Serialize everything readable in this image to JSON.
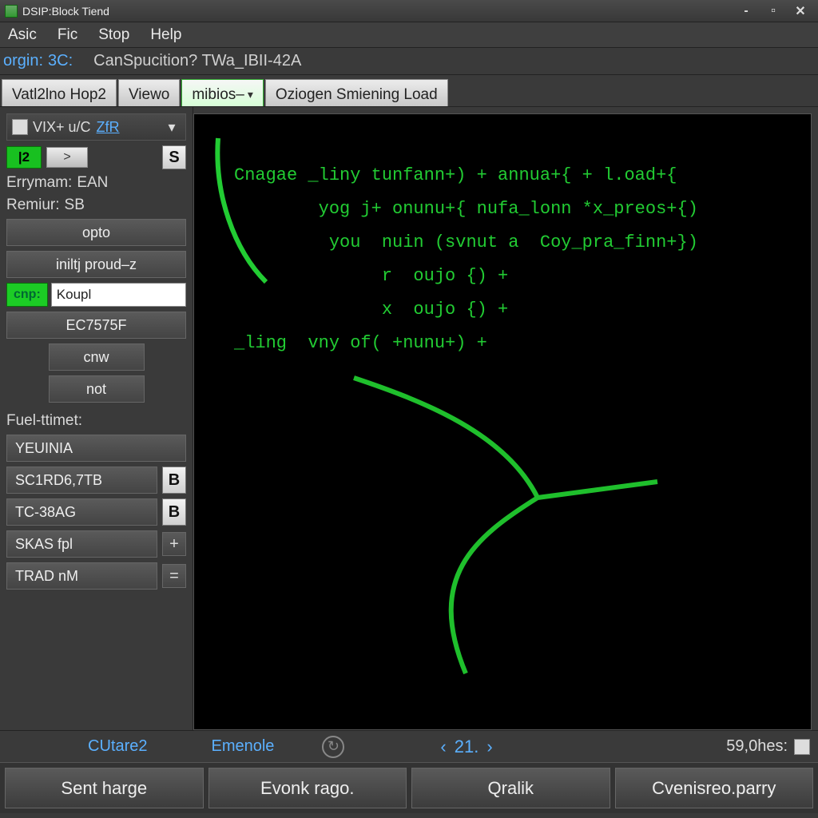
{
  "titlebar": {
    "title": "DSIP:Block Tiend"
  },
  "menubar": [
    "Asic",
    "Fic",
    "Stop",
    "Help"
  ],
  "info": {
    "label": "orgin:",
    "val1": "3C:",
    "val2": "CanSpucition?  TWa_IBII-42A"
  },
  "tabs": {
    "t1": "Vatl2lno Hop2",
    "t2": "Viewo",
    "t3": "mibios–",
    "t4": "Oziogen Smiening Load"
  },
  "sidebar": {
    "header_a": "VIX+ u/C ",
    "header_b": "ZfR",
    "num": "|2",
    "arrow": ">",
    "s": "S",
    "errymam_l": "Errymam:",
    "errymam_v": "EAN",
    "remiur_l": "Remiur:",
    "remiur_v": "SB",
    "opto": "opto",
    "iniltj": "iniltj proud–z",
    "cnp": "cnp:",
    "koupl": "Koupl",
    "ec": "EC7575F",
    "cnw": "cnw",
    "not": "not",
    "fuel": "Fuel-ttimet:",
    "y": "YEUINIA",
    "sc": "SC1RD6,7TB",
    "sc_b": "B",
    "tc": "TC-38AG",
    "tc_b": "B",
    "skas": "SKAS  fpl",
    "trad": "TRAD  nM"
  },
  "code_lines": [
    "Cnagae _liny tunfann+) + annua+{ + l.oad+{",
    "        yog j+ onunu+{ nufa_lonn *x_preos+{)",
    "         you  nuin (svnut a  Coy_pra_finn+})",
    "              r  oujo {) +",
    "              x  oujo {) +",
    "_ling  vny of( +nunu+) +"
  ],
  "status": {
    "c": "CUtare2",
    "emenole": "Emenole",
    "page": "21.",
    "right": "59,0hes:"
  },
  "bottom": {
    "b1": "Sent harge",
    "b2": "Evonk rago.",
    "b3": "Qralik",
    "b4": "Cvenisreo.parry"
  }
}
